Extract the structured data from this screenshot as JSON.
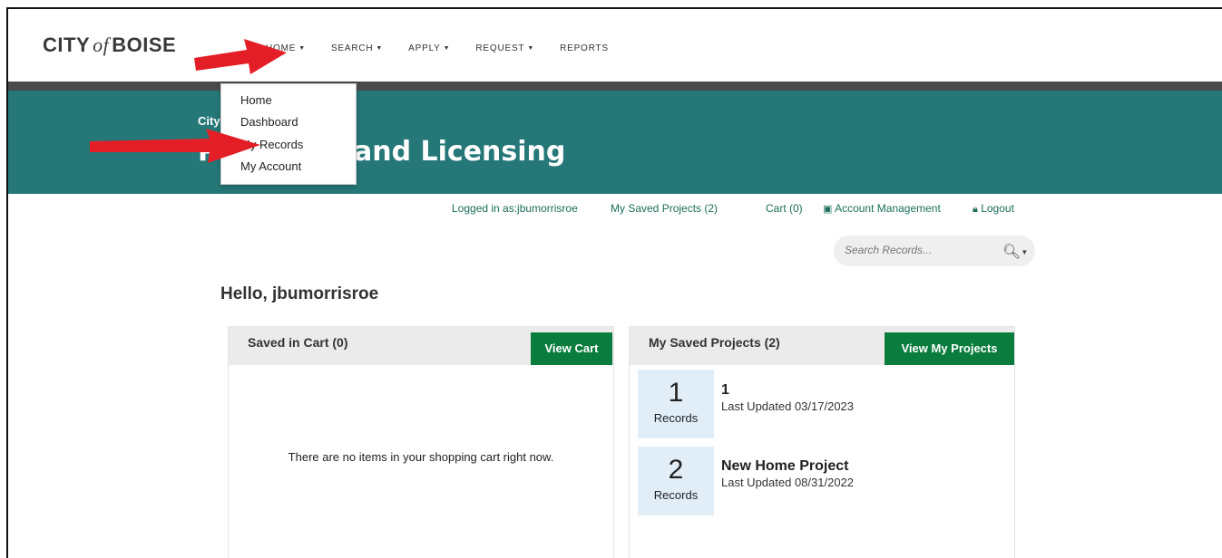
{
  "brand": {
    "city": "CITY",
    "of": "of",
    "name": "BOISE"
  },
  "nav": [
    {
      "label": "HOME",
      "caret": true
    },
    {
      "label": "SEARCH",
      "caret": true
    },
    {
      "label": "APPLY",
      "caret": true
    },
    {
      "label": "REQUEST",
      "caret": true
    },
    {
      "label": "REPORTS",
      "caret": false
    }
  ],
  "dropdown": {
    "items": [
      "Home",
      "Dashboard",
      "My Records",
      "My Account"
    ]
  },
  "banner": {
    "subtitle": "City",
    "title": "and Licensing",
    "title_prefix": "P"
  },
  "userbar": {
    "logged_in": "Logged in as:jbumorrisroe",
    "saved_projects": "My Saved Projects (2)",
    "cart": "Cart (0)",
    "account": "Account Management",
    "logout": "Logout"
  },
  "search": {
    "placeholder": "Search Records..."
  },
  "greeting": "Hello, jbumorrisroe",
  "cart_panel": {
    "title": "Saved in Cart (0)",
    "button": "View Cart",
    "empty_message": "There are no items in your shopping cart right now."
  },
  "projects_panel": {
    "title": "My Saved Projects (2)",
    "button": "View My Projects",
    "projects": [
      {
        "count": "1",
        "count_label": "Records",
        "name": "1",
        "updated": "Last Updated 03/17/2023"
      },
      {
        "count": "2",
        "count_label": "Records",
        "name": "New Home Project",
        "updated": "Last Updated 08/31/2022"
      }
    ]
  },
  "colors": {
    "banner": "#267878",
    "button": "#0a7d3e",
    "link": "#1a6e5a",
    "arrow": "#e41e26"
  }
}
